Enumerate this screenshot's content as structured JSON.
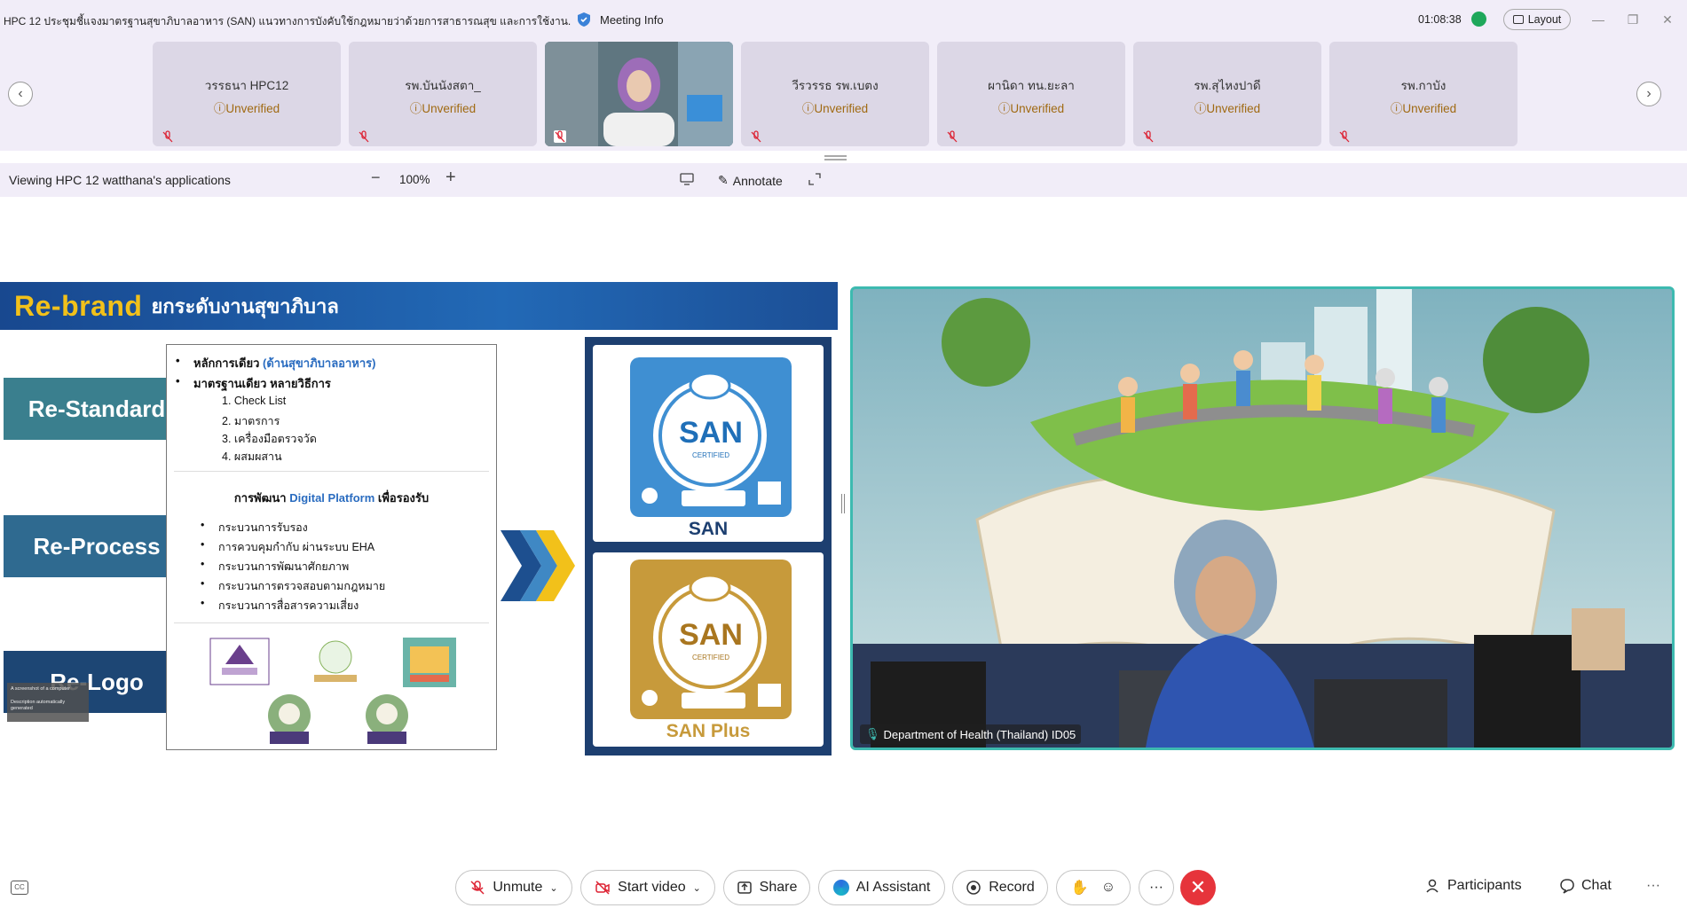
{
  "titlebar": {
    "title": "HPC 12 ประชุมชี้แจงมาตรฐานสุขาภิบาลอาหาร (SAN) แนวทางการบังคับใช้กฎหมายว่าด้วยการสาธารณสุข และการใช้งาน...",
    "meeting_info": "Meeting Info",
    "timer": "01:08:38",
    "layout_label": "Layout"
  },
  "participants": [
    {
      "name": "วรรธนา HPC12",
      "status": "Unverified"
    },
    {
      "name": "รพ.บันนังสตา_",
      "status": "Unverified"
    },
    {
      "name": "",
      "status": ""
    },
    {
      "name": "วีรวรรธ รพ.เบตง",
      "status": "Unverified"
    },
    {
      "name": "ผานิดา ทน.ยะลา",
      "status": "Unverified"
    },
    {
      "name": "รพ.สุไหงปาดี",
      "status": "Unverified"
    },
    {
      "name": "รพ.กาบัง",
      "status": "Unverified"
    }
  ],
  "viewbar": {
    "viewing_label": "Viewing HPC 12 watthana's applications",
    "zoom": "100%",
    "minus": "−",
    "plus": "+",
    "annotate": "Annotate"
  },
  "slide": {
    "header_big": "Re-brand",
    "header_thai": "ยกระดับงานสุขาภิบาล",
    "labels": [
      "Re-Standard",
      "Re-Process",
      "Re-Logo"
    ],
    "principle_prefix": "หลักการเดียว",
    "principle_paren": "(ด้านสุขาภิบาลอาหาร)",
    "standard_line": "มาตรฐานเดียว หลายวิธีการ",
    "numbered": [
      "1. Check List",
      "2. มาตรการ",
      "3. เครื่องมือตรวจวัด",
      "4. ผสมผสาน"
    ],
    "digital_prefix": "การพัฒนา",
    "digital_mid": "Digital Platform",
    "digital_suffix": "เพื่อรองรับ",
    "process_items": [
      "กระบวนการรับรอง",
      "การควบคุมกำกับ ผ่านระบบ EHA",
      "กระบวนการพัฒนาศักยภาพ",
      "กระบวนการตรวจสอบตามกฎหมาย",
      "กระบวนการสื่อสารความเสี่ยง"
    ],
    "logo_san": "SAN",
    "logo_san_plus": "SAN Plus",
    "badge_text": "SAN",
    "badge_sub": "CERTIFIED",
    "tooltip_line1": "A screenshot of a computer",
    "tooltip_line2": "Description automatically generated"
  },
  "speaker": {
    "name": "Department of Health (Thailand) ID05"
  },
  "controls": {
    "unmute": "Unmute",
    "start_video": "Start video",
    "share": "Share",
    "ai_assistant": "AI Assistant",
    "record": "Record",
    "participants": "Participants",
    "chat": "Chat",
    "more": "···"
  },
  "colors": {
    "accent_teal": "#3dbab0",
    "end_red": "#e6343b",
    "slide_blue": "#18488f",
    "slide_gold": "#f2c11a",
    "san_blue": "#3f8fd2",
    "san_gold": "#c79a3b"
  }
}
